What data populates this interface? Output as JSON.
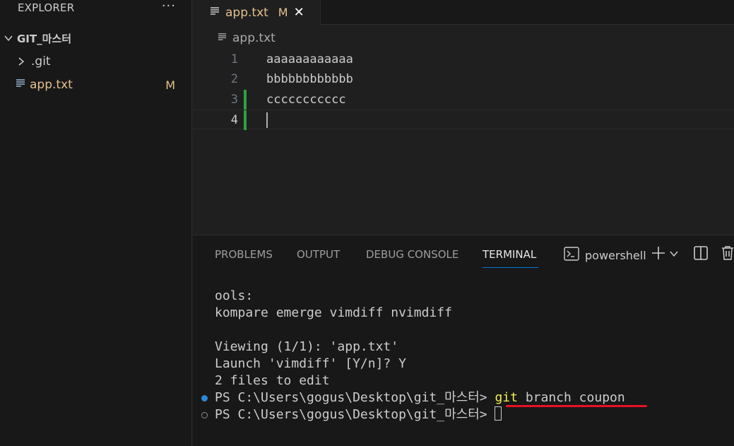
{
  "sidebar": {
    "header": "EXPLORER",
    "more": "···",
    "root_folder": "GIT_마스터",
    "items": [
      {
        "label": ".git",
        "kind": "folder"
      },
      {
        "label": "app.txt",
        "kind": "file",
        "status": "M"
      }
    ]
  },
  "editor": {
    "tab": {
      "label": "app.txt",
      "status": "M",
      "close": "✕"
    },
    "breadcrumb": "app.txt",
    "lines": [
      {
        "num": "1",
        "text": "aaaaaaaaaaaa"
      },
      {
        "num": "2",
        "text": "bbbbbbbbbbbb"
      },
      {
        "num": "3",
        "text": "ccccccccccc"
      },
      {
        "num": "4",
        "text": ""
      }
    ]
  },
  "panel": {
    "tabs": [
      "PROBLEMS",
      "OUTPUT",
      "DEBUG CONSOLE",
      "TERMINAL"
    ],
    "active_tab": "TERMINAL",
    "shell": "powershell"
  },
  "terminal": {
    "lines": [
      "ools:",
      "kompare emerge vimdiff nvimdiff",
      "",
      "Viewing (1/1): 'app.txt'",
      "Launch 'vimdiff' [Y/n]? Y",
      "2 files to edit"
    ],
    "prompt": "PS C:\\Users\\gogus\\Desktop\\git_마스터> ",
    "command_git": "git",
    "command_rest": " branch coupon"
  },
  "colors": {
    "accent": "#0078d4",
    "modified": "#e2c08d",
    "added_gutter": "#2ea043",
    "annotation_underline": "#e81123"
  }
}
